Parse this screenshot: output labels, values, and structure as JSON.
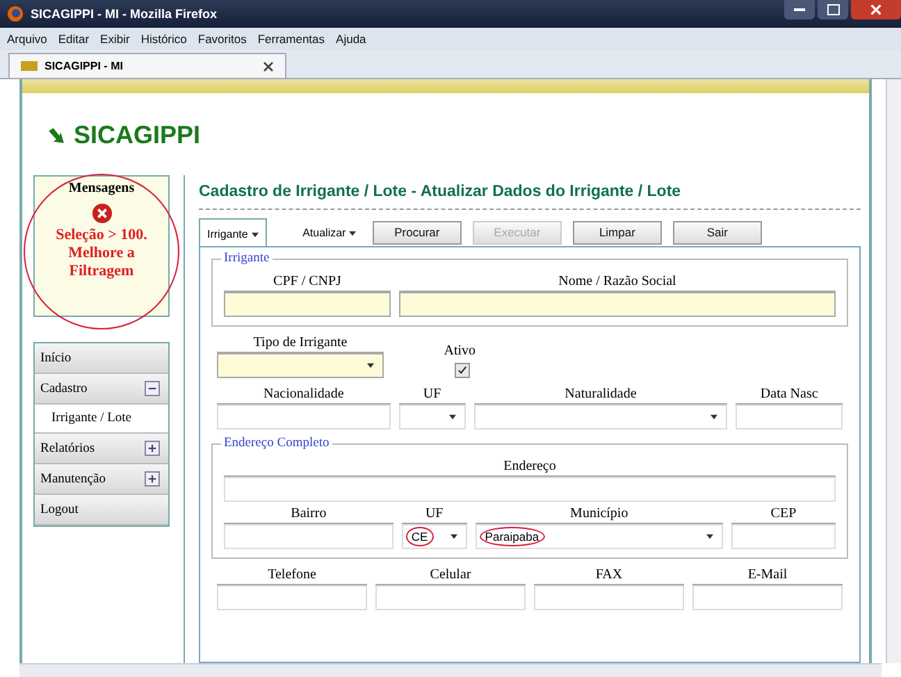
{
  "window": {
    "title": "SICAGIPPI - MI - Mozilla Firefox"
  },
  "menu_bar": [
    "Arquivo",
    "Editar",
    "Exibir",
    "Histórico",
    "Favoritos",
    "Ferramentas",
    "Ajuda"
  ],
  "browser_tab": {
    "title": "SICAGIPPI - MI"
  },
  "site": {
    "logo": "SICAGIPPI"
  },
  "messages": {
    "title": "Mensagens",
    "text": "Seleção > 100. Melhore a Filtragem",
    "circled": true
  },
  "sidebar": [
    {
      "label": "Início",
      "kind": "link"
    },
    {
      "label": "Cadastro",
      "kind": "group",
      "expanded": true,
      "children": [
        {
          "label": "Irrigante / Lote"
        }
      ]
    },
    {
      "label": "Relatórios",
      "kind": "group",
      "expanded": false
    },
    {
      "label": "Manutenção",
      "kind": "group",
      "expanded": false
    },
    {
      "label": "Logout",
      "kind": "link"
    }
  ],
  "page_title": "Cadastro de Irrigante / Lote - Atualizar Dados do Irrigante / Lote",
  "toolbar": {
    "entity": "Irrigante",
    "action": "Atualizar",
    "buttons": [
      {
        "label": "Procurar",
        "disabled": false
      },
      {
        "label": "Executar",
        "disabled": true
      },
      {
        "label": "Limpar",
        "disabled": false
      },
      {
        "label": "Sair",
        "disabled": false
      }
    ]
  },
  "irrigante": {
    "legend": "Irrigante",
    "fields": [
      {
        "label": "CPF / CNPJ",
        "highlighted": true
      },
      {
        "label": "Nome / Razão Social",
        "highlighted": true
      }
    ]
  },
  "rows": [
    [
      {
        "label": "Tipo de Irrigante",
        "kind": "select",
        "highlighted": true
      },
      {
        "label": "Ativo",
        "kind": "checkbox",
        "checked": true
      }
    ],
    [
      {
        "label": "Nacionalidade",
        "kind": "text",
        "highlighted": false
      },
      {
        "label": "UF",
        "kind": "select",
        "highlighted": false
      },
      {
        "label": "Naturalidade",
        "kind": "select",
        "highlighted": false
      },
      {
        "label": "Data Nasc",
        "kind": "text",
        "highlighted": false
      }
    ]
  ],
  "endereco": {
    "legend": "Endereço Completo",
    "address": {
      "label": "Endereço",
      "highlighted": false
    },
    "fields": [
      {
        "label": "Bairro",
        "kind": "text",
        "highlighted": false
      },
      {
        "label": "UF",
        "kind": "select",
        "highlighted": false,
        "value": "CE",
        "circled": true
      },
      {
        "label": "Município",
        "kind": "select",
        "highlighted": false,
        "value": "Paraipaba",
        "circled": true
      },
      {
        "label": "CEP",
        "kind": "text",
        "highlighted": false
      }
    ]
  },
  "contact_row": [
    {
      "label": "Telefone",
      "highlighted": false
    },
    {
      "label": "Celular",
      "highlighted": false
    },
    {
      "label": "FAX",
      "highlighted": false
    },
    {
      "label": "E-Mail",
      "highlighted": false
    }
  ]
}
